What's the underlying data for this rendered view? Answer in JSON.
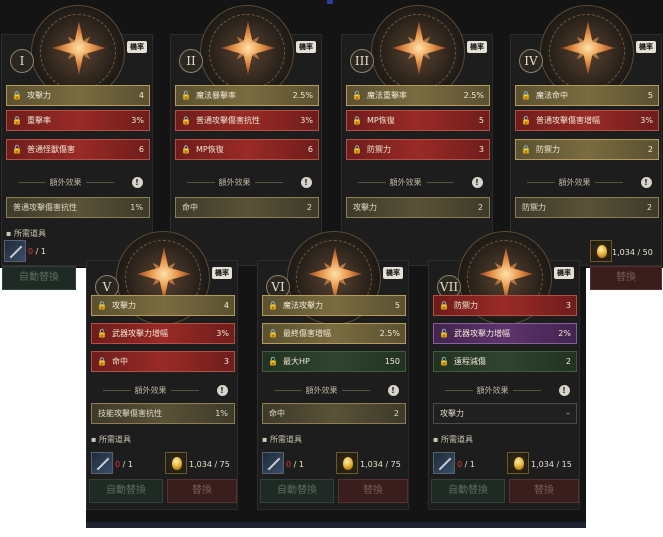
{
  "cards": [
    {
      "numeral": "I",
      "rate": "機率",
      "stats": [
        {
          "name": "攻擊力",
          "value": "4",
          "color": "gold",
          "icon": "lock-icon"
        },
        {
          "name": "重擊率",
          "value": "3%",
          "color": "red",
          "icon": "lock-icon"
        },
        {
          "name": "普通怪獸傷害",
          "value": "6",
          "color": "red",
          "icon": "unlock-icon"
        }
      ],
      "extra_title": "額外效果",
      "extra": {
        "name": "普通攻擊傷害抗性",
        "value": "1%",
        "style": "gold"
      },
      "required_label": "所需道具",
      "item_count": "0",
      "item_total": "/ 1",
      "gold": "",
      "auto_label": "自動替換",
      "swap_label": ""
    },
    {
      "numeral": "II",
      "rate": "機率",
      "stats": [
        {
          "name": "魔法暴擊率",
          "value": "2.5%",
          "color": "gold",
          "icon": "unlock-icon"
        },
        {
          "name": "普通攻擊傷害抗性",
          "value": "3%",
          "color": "red",
          "icon": "lock-icon"
        },
        {
          "name": "MP恢復",
          "value": "6",
          "color": "red",
          "icon": "lock-icon"
        }
      ],
      "extra_title": "額外效果",
      "extra": {
        "name": "命中",
        "value": "2",
        "style": "gold"
      }
    },
    {
      "numeral": "III",
      "rate": "機率",
      "stats": [
        {
          "name": "魔法重擊率",
          "value": "2.5%",
          "color": "gold",
          "icon": "unlock-icon"
        },
        {
          "name": "MP恢復",
          "value": "5",
          "color": "red",
          "icon": "lock-icon"
        },
        {
          "name": "防禦力",
          "value": "3",
          "color": "red",
          "icon": "lock-icon"
        }
      ],
      "extra_title": "額外效果",
      "extra": {
        "name": "攻擊力",
        "value": "2",
        "style": "gold"
      }
    },
    {
      "numeral": "IV",
      "rate": "機率",
      "stats": [
        {
          "name": "魔法命中",
          "value": "5",
          "color": "gold",
          "icon": "lock-icon"
        },
        {
          "name": "普通攻擊傷害增幅",
          "value": "3%",
          "color": "red",
          "icon": "unlock-icon"
        },
        {
          "name": "防禦力",
          "value": "2",
          "color": "gold",
          "icon": "lock-icon"
        }
      ],
      "extra_title": "額外效果",
      "extra": {
        "name": "防禦力",
        "value": "2",
        "style": "gold"
      },
      "gold": "1,034 / 50",
      "swap_label": "替換"
    },
    {
      "numeral": "V",
      "rate": "機率",
      "stats": [
        {
          "name": "攻擊力",
          "value": "4",
          "color": "gold",
          "icon": "lock-icon"
        },
        {
          "name": "武器攻擊力增幅",
          "value": "3%",
          "color": "red",
          "icon": "unlock-icon"
        },
        {
          "name": "命中",
          "value": "3",
          "color": "red",
          "icon": "lock-icon"
        }
      ],
      "extra_title": "額外效果",
      "extra": {
        "name": "技能攻擊傷害抗性",
        "value": "1%",
        "style": "gold"
      },
      "required_label": "所需道具",
      "item_count": "0",
      "item_total": "/ 1",
      "gold": "1,034 / 75",
      "auto_label": "自動替換",
      "swap_label": "替換"
    },
    {
      "numeral": "VI",
      "rate": "機率",
      "stats": [
        {
          "name": "魔法攻擊力",
          "value": "5",
          "color": "gold",
          "icon": "lock-icon"
        },
        {
          "name": "最終傷害增幅",
          "value": "2.5%",
          "color": "gold",
          "icon": "lock-icon"
        },
        {
          "name": "最大HP",
          "value": "150",
          "color": "green",
          "icon": "unlock-icon"
        }
      ],
      "extra_title": "額外效果",
      "extra": {
        "name": "命中",
        "value": "2",
        "style": "gold"
      },
      "required_label": "所需道具",
      "item_count": "0",
      "item_total": "/ 1",
      "gold": "1,034 / 75",
      "auto_label": "自動替換",
      "swap_label": "替換"
    },
    {
      "numeral": "VII",
      "rate": "機率",
      "stats": [
        {
          "name": "防禦力",
          "value": "3",
          "color": "red",
          "icon": "lock-icon"
        },
        {
          "name": "武器攻擊力增幅",
          "value": "2%",
          "color": "purple",
          "icon": "unlock-icon"
        },
        {
          "name": "遠程減傷",
          "value": "2",
          "color": "green",
          "icon": "unlock-icon"
        }
      ],
      "extra_title": "額外效果",
      "extra": {
        "name": "攻擊力",
        "value": "–",
        "style": "dark"
      },
      "required_label": "所需道具",
      "item_count": "0",
      "item_total": "/ 1",
      "gold": "1,034 / 15",
      "auto_label": "自動替換",
      "swap_label": "替換"
    }
  ]
}
